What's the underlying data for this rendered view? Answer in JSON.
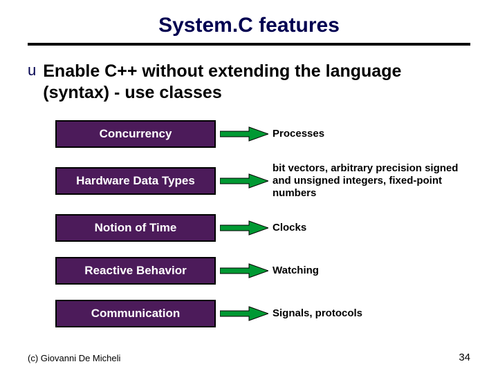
{
  "title": "System.C features",
  "bullet_marker": "u",
  "subtitle": "Enable C++ without extending the language (syntax)  - use  classes",
  "rows": [
    {
      "box": "Concurrency",
      "desc": "Processes"
    },
    {
      "box": "Hardware Data Types",
      "desc": "bit vectors, arbitrary precision signed and unsigned integers, fixed-point numbers"
    },
    {
      "box": "Notion of Time",
      "desc": "Clocks"
    },
    {
      "box": "Reactive Behavior",
      "desc": "Watching"
    },
    {
      "box": "Communication",
      "desc": "Signals, protocols"
    }
  ],
  "arrow_fill": "#009933",
  "footer": "(c)  Giovanni De Micheli",
  "pagenum": "34"
}
